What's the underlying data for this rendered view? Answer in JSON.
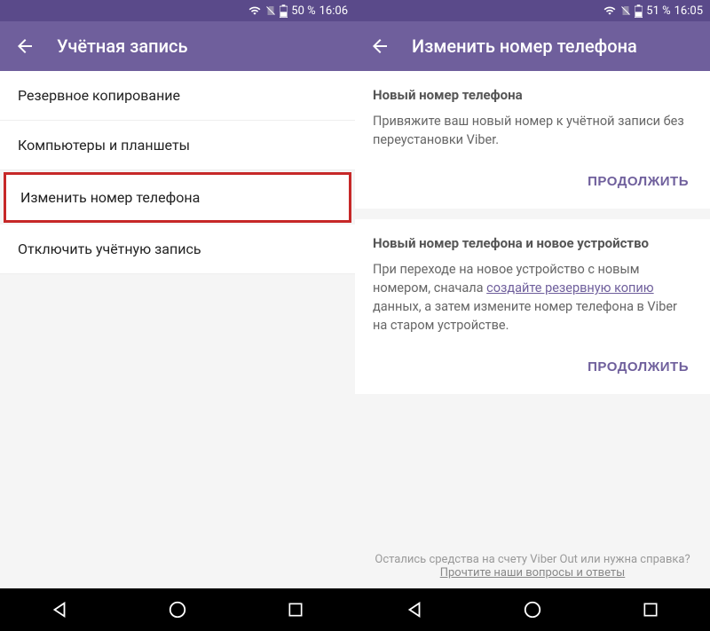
{
  "left": {
    "status": {
      "battery": "50 %",
      "time": "16:06"
    },
    "title": "Учётная запись",
    "items": [
      {
        "label": "Резервное копирование",
        "highlighted": false
      },
      {
        "label": "Компьютеры и планшеты",
        "highlighted": false
      },
      {
        "label": "Изменить номер телефона",
        "highlighted": true
      },
      {
        "label": "Отключить учётную запись",
        "highlighted": false
      }
    ]
  },
  "right": {
    "status": {
      "battery": "51 %",
      "time": "16:05"
    },
    "title": "Изменить номер телефона",
    "sections": [
      {
        "title": "Новый номер телефона",
        "body_pre": "Привяжите ваш новый номер к учётной записи без переустановки Viber.",
        "link": "",
        "body_post": "",
        "action": "ПРОДОЛЖИТЬ"
      },
      {
        "title": "Новый номер телефона и новое устройство",
        "body_pre": "При переходе на новое устройство с новым номером, сначала ",
        "link": "создайте резервную копию",
        "body_post": " данных, а затем измените номер телефона в Viber на старом устройстве.",
        "action": "ПРОДОЛЖИТЬ"
      }
    ],
    "footer": {
      "line1": "Остались средства на счету Viber Out или нужна справка?",
      "line2": "Прочтите наши вопросы и ответы"
    }
  }
}
